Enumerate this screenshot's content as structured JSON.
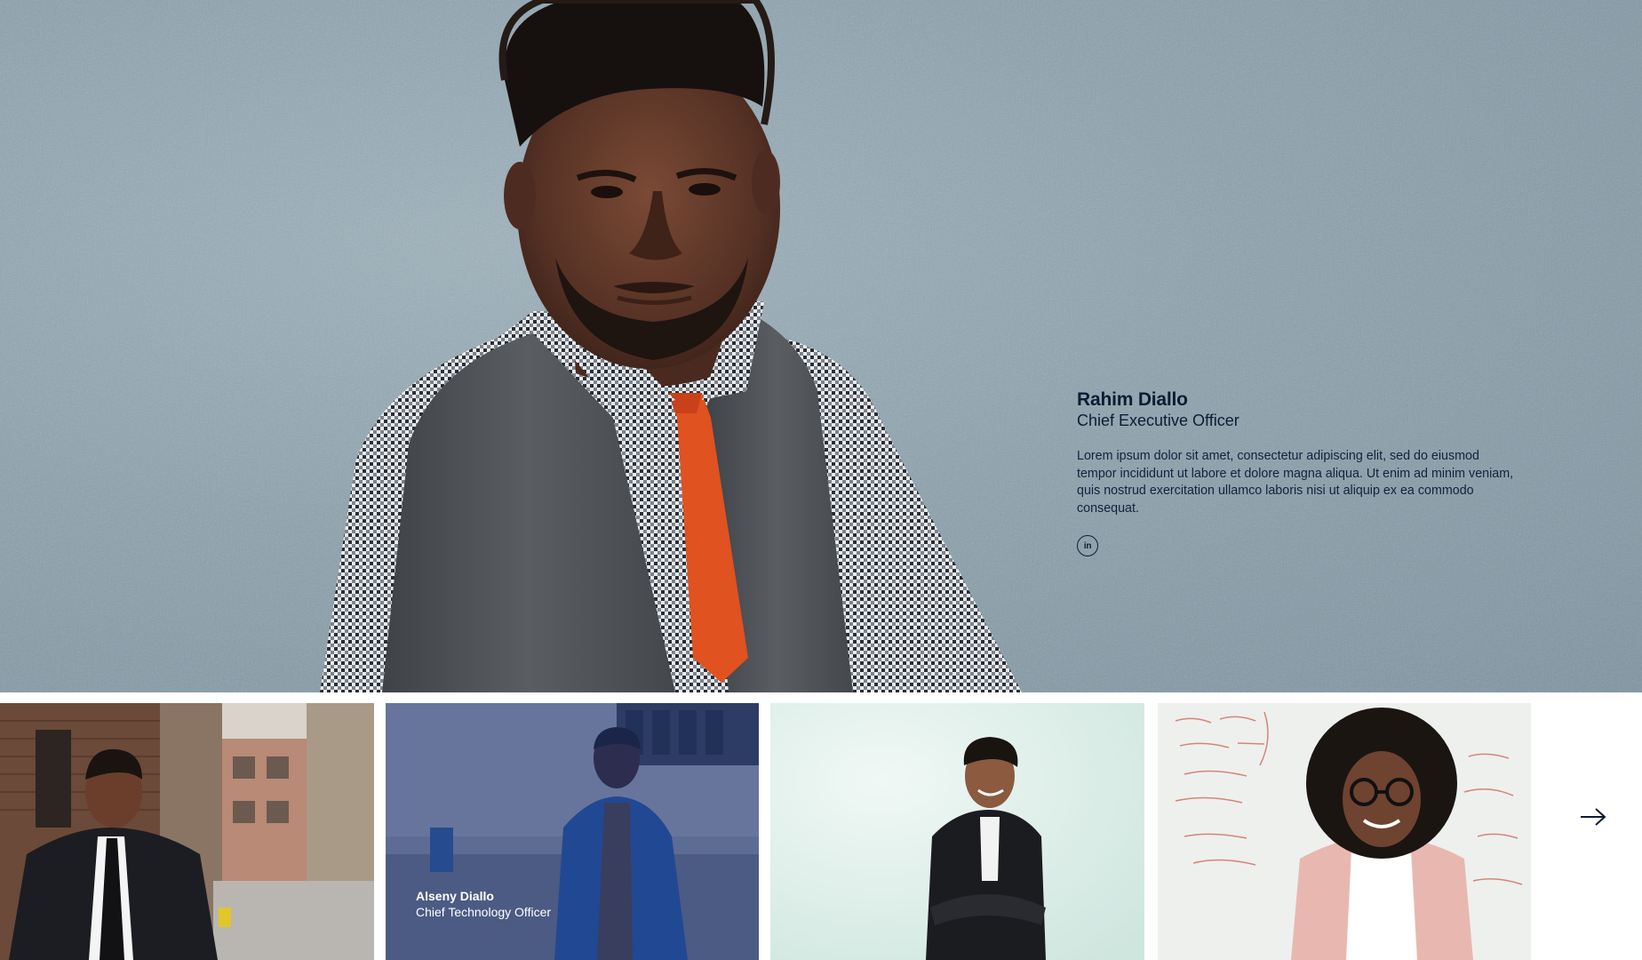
{
  "featured": {
    "name": "Rahim Diallo",
    "role": "Chief Executive Officer",
    "bio": "Lorem ipsum dolor sit amet, consectetur adipiscing elit, sed do eiusmod tempor incididunt ut labore et dolore magna aliqua. Ut enim ad minim veniam, quis nostrud exercitation ullamco laboris nisi ut aliquip ex ea commodo consequat.",
    "social_icon": "linkedin-icon",
    "social_label": "in"
  },
  "team": [
    {
      "name": "",
      "role": ""
    },
    {
      "name": "Alseny Diallo",
      "role": "Chief Technology Officer",
      "highlighted": true
    },
    {
      "name": "",
      "role": ""
    },
    {
      "name": "",
      "role": ""
    }
  ],
  "navigation": {
    "next_icon": "arrow-right-icon"
  },
  "colors": {
    "text_dark": "#0f1b33",
    "hero_background": "#8ea3ae",
    "card_overlay": "#1b306c",
    "caption_text": "#ffffff"
  }
}
